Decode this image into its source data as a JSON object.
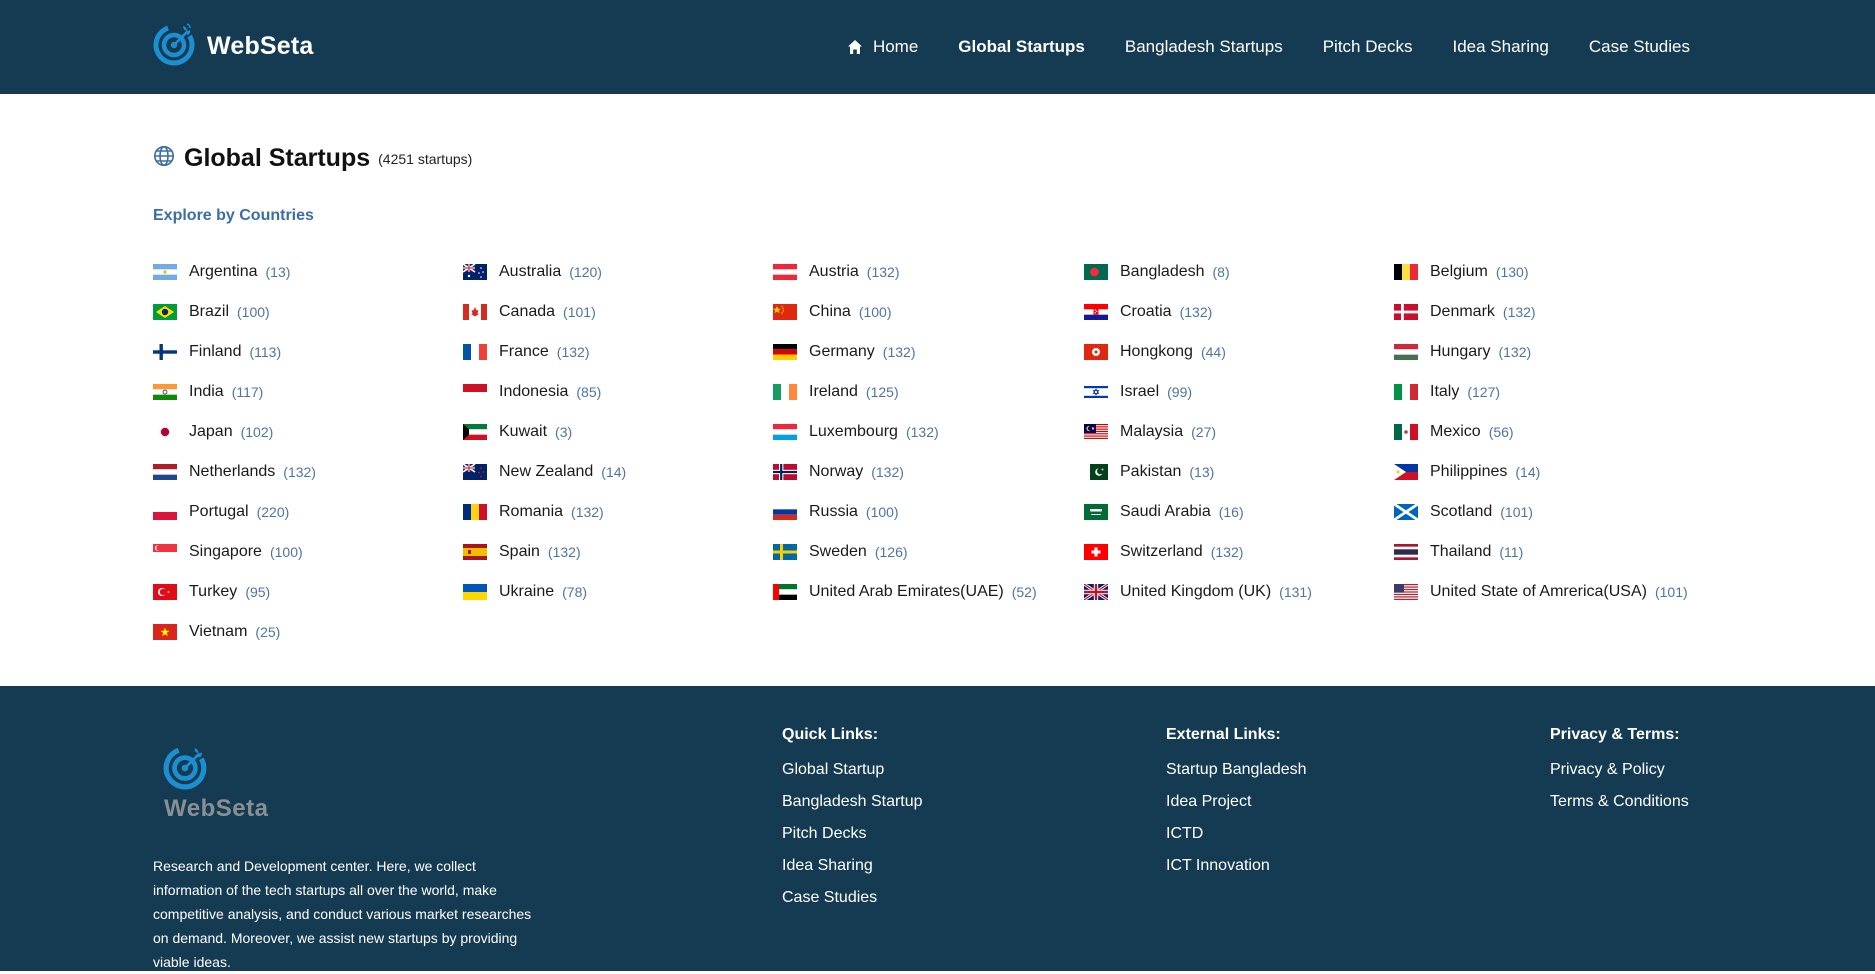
{
  "header": {
    "brand": "WebSeta",
    "nav": [
      {
        "label": "Home",
        "icon": "home-icon"
      },
      {
        "label": "Global Startups",
        "active": true
      },
      {
        "label": "Bangladesh Startups"
      },
      {
        "label": "Pitch Decks"
      },
      {
        "label": "Idea Sharing"
      },
      {
        "label": "Case Studies"
      }
    ]
  },
  "main": {
    "title": "Global Startups",
    "count_note": "(4251 startups)",
    "section_label": "Explore by Countries",
    "countries": [
      {
        "name": "Argentina",
        "count": "(13)"
      },
      {
        "name": "Australia",
        "count": "(120)"
      },
      {
        "name": "Austria",
        "count": "(132)"
      },
      {
        "name": "Bangladesh",
        "count": "(8)"
      },
      {
        "name": "Belgium",
        "count": "(130)"
      },
      {
        "name": "Brazil",
        "count": "(100)"
      },
      {
        "name": "Canada",
        "count": "(101)"
      },
      {
        "name": "China",
        "count": "(100)"
      },
      {
        "name": "Croatia",
        "count": "(132)"
      },
      {
        "name": "Denmark",
        "count": "(132)"
      },
      {
        "name": "Finland",
        "count": "(113)"
      },
      {
        "name": "France",
        "count": "(132)"
      },
      {
        "name": "Germany",
        "count": "(132)"
      },
      {
        "name": "Hongkong",
        "count": "(44)"
      },
      {
        "name": "Hungary",
        "count": "(132)"
      },
      {
        "name": "India",
        "count": "(117)"
      },
      {
        "name": "Indonesia",
        "count": "(85)"
      },
      {
        "name": "Ireland",
        "count": "(125)"
      },
      {
        "name": "Israel",
        "count": "(99)"
      },
      {
        "name": "Italy",
        "count": "(127)"
      },
      {
        "name": "Japan",
        "count": "(102)"
      },
      {
        "name": "Kuwait",
        "count": "(3)"
      },
      {
        "name": "Luxembourg",
        "count": "(132)"
      },
      {
        "name": "Malaysia",
        "count": "(27)"
      },
      {
        "name": "Mexico",
        "count": "(56)"
      },
      {
        "name": "Netherlands",
        "count": "(132)"
      },
      {
        "name": "New Zealand",
        "count": "(14)"
      },
      {
        "name": "Norway",
        "count": "(132)"
      },
      {
        "name": "Pakistan",
        "count": "(13)"
      },
      {
        "name": "Philippines",
        "count": "(14)"
      },
      {
        "name": "Portugal",
        "count": "(220)"
      },
      {
        "name": "Romania",
        "count": "(132)"
      },
      {
        "name": "Russia",
        "count": "(100)"
      },
      {
        "name": "Saudi Arabia",
        "count": "(16)"
      },
      {
        "name": "Scotland",
        "count": "(101)"
      },
      {
        "name": "Singapore",
        "count": "(100)"
      },
      {
        "name": "Spain",
        "count": "(132)"
      },
      {
        "name": "Sweden",
        "count": "(126)"
      },
      {
        "name": "Switzerland",
        "count": "(132)"
      },
      {
        "name": "Thailand",
        "count": "(11)"
      },
      {
        "name": "Turkey",
        "count": "(95)"
      },
      {
        "name": "Ukraine",
        "count": "(78)"
      },
      {
        "name": "United Arab Emirates(UAE)",
        "count": "(52)"
      },
      {
        "name": "United Kingdom (UK)",
        "count": "(131)"
      },
      {
        "name": "United State of Amrerica(USA)",
        "count": "(101)"
      },
      {
        "name": "Vietnam",
        "count": "(25)"
      }
    ]
  },
  "footer": {
    "logo_text": "WebSeta",
    "description": "Research and Development center. Here, we collect information of the tech startups all over the world, make competitive analysis, and conduct various market researches on demand. Moreover, we assist new startups by providing viable ideas.",
    "columns": [
      {
        "heading": "Quick Links:",
        "links": [
          "Global Startup",
          "Bangladesh Startup",
          "Pitch Decks",
          "Idea Sharing",
          "Case Studies"
        ]
      },
      {
        "heading": "External Links:",
        "links": [
          "Startup Bangladesh",
          "Idea Project",
          "ICTD",
          "ICT Innovation"
        ]
      },
      {
        "heading": "Privacy & Terms:",
        "links": [
          "Privacy & Policy",
          "Terms & Conditions"
        ]
      }
    ]
  },
  "colors": {
    "header_bg": "#143b52",
    "footer_bg": "#143b52",
    "accent": "#3a6ea5",
    "count_text": "#4e74a6",
    "logo_blue": "#1d8fd1"
  }
}
